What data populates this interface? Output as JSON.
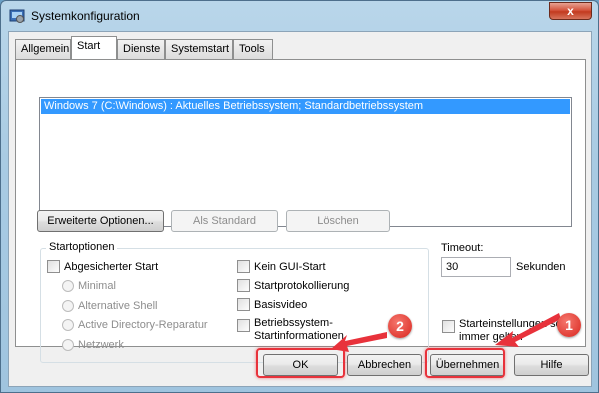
{
  "window": {
    "title": "Systemkonfiguration",
    "close_glyph": "x"
  },
  "tabs": [
    {
      "label": "Allgemein"
    },
    {
      "label": "Start"
    },
    {
      "label": "Dienste"
    },
    {
      "label": "Systemstart"
    },
    {
      "label": "Tools"
    }
  ],
  "active_tab": "Start",
  "os_list": {
    "items": [
      "Windows 7 (C:\\Windows) : Aktuelles Betriebssystem; Standardbetriebssystem"
    ],
    "selected_index": 0
  },
  "buttons": {
    "advanced": "Erweiterte Optionen...",
    "set_default": "Als Standard",
    "delete": "Löschen",
    "ok": "OK",
    "cancel": "Abbrechen",
    "apply": "Übernehmen",
    "help": "Hilfe"
  },
  "boot_options": {
    "title": "Startoptionen",
    "safe_boot": "Abgesicherter Start",
    "radios": [
      "Minimal",
      "Alternative Shell",
      "Active Directory-Reparatur",
      "Netzwerk"
    ],
    "no_gui": "Kein GUI-Start",
    "boot_log": "Startprotokollierung",
    "base_video": "Basisvideo",
    "os_info_line1": "Betriebssystem-",
    "os_info_line2": "Startinformationen"
  },
  "timeout": {
    "label": "Timeout:",
    "value": "30",
    "unit": "Sekunden"
  },
  "permanent": {
    "line1": "Starteinstellungen sollen",
    "line2": "immer gelten"
  },
  "annotations": {
    "badge_1": "1",
    "badge_2": "2",
    "color": "#e8323b"
  }
}
